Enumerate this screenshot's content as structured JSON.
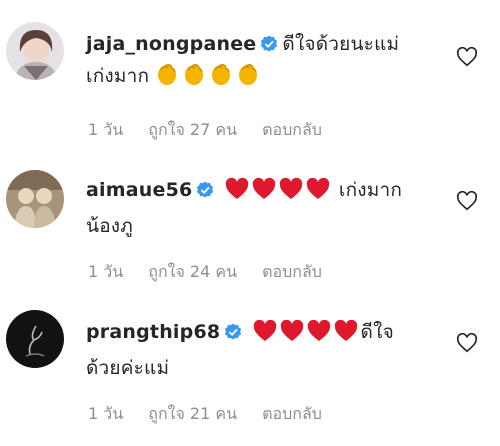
{
  "comments": [
    {
      "username": "jaja_nongpanee",
      "text_line1": "ดีใจด้วยนะแม่",
      "text_line2": "เก่งมาก",
      "emoji": [
        "clapping-hands",
        "clapping-hands",
        "clapping-hands",
        "clapping-hands"
      ],
      "time": "1 วัน",
      "likes": "ถูกใจ 27 คน",
      "reply": "ตอบกลับ"
    },
    {
      "username": "aimaue56",
      "emoji": [
        "red-heart",
        "red-heart",
        "red-heart",
        "red-heart"
      ],
      "text_line1": "เก่งมาก",
      "text_line2": "น้องภู",
      "time": "1 วัน",
      "likes": "ถูกใจ 24 คน",
      "reply": "ตอบกลับ"
    },
    {
      "username": "prangthip68",
      "emoji": [
        "red-heart",
        "red-heart",
        "red-heart",
        "red-heart"
      ],
      "text_line1": "ดีใจ",
      "text_line2": "ด้วยค่ะแม่",
      "time": "1 วัน",
      "likes": "ถูกใจ 21 คน",
      "reply": "ตอบกลับ"
    }
  ],
  "colors": {
    "verified": "#3897f0",
    "meta": "#8e8e8e",
    "heart": "#e0182d",
    "clap": "#f4b400"
  }
}
